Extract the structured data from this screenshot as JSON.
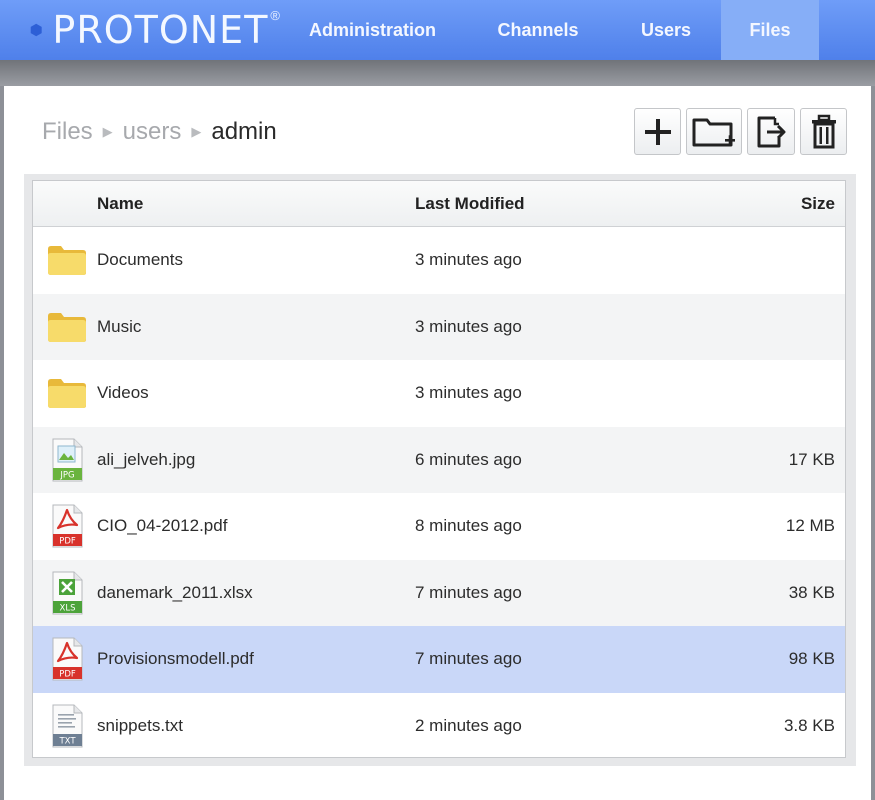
{
  "brand": {
    "name": "PROTONET",
    "reg": "®",
    "color": "#4f80ea"
  },
  "nav": [
    {
      "label": "Administration",
      "active": false
    },
    {
      "label": "Channels",
      "active": false
    },
    {
      "label": "Users",
      "active": false
    },
    {
      "label": "Files",
      "active": true
    }
  ],
  "breadcrumb": [
    {
      "label": "Files"
    },
    {
      "label": "users"
    },
    {
      "label": "admin"
    }
  ],
  "breadcrumb_sep": "▶",
  "toolbar": [
    {
      "icon": "plus-icon"
    },
    {
      "icon": "new-folder-icon"
    },
    {
      "icon": "export-icon"
    },
    {
      "icon": "trash-icon"
    }
  ],
  "table": {
    "headers": {
      "name": "Name",
      "modified": "Last Modified",
      "size": "Size"
    },
    "rows": [
      {
        "icon": "folder-icon",
        "type": "folder",
        "name": "Documents",
        "modified": "3 minutes ago",
        "size": ""
      },
      {
        "icon": "folder-icon",
        "type": "folder",
        "name": "Music",
        "modified": "3 minutes ago",
        "size": ""
      },
      {
        "icon": "folder-icon",
        "type": "folder",
        "name": "Videos",
        "modified": "3 minutes ago",
        "size": ""
      },
      {
        "icon": "jpg-file-icon",
        "type": "jpg",
        "badge": "JPG",
        "name": "ali_jelveh.jpg",
        "modified": "6 minutes ago",
        "size": "17 KB"
      },
      {
        "icon": "pdf-file-icon",
        "type": "pdf",
        "badge": "PDF",
        "name": "CIO_04-2012.pdf",
        "modified": "8 minutes ago",
        "size": "12 MB"
      },
      {
        "icon": "xls-file-icon",
        "type": "xls",
        "badge": "XLS",
        "name": "danemark_2011.xlsx",
        "modified": "7 minutes ago",
        "size": "38 KB"
      },
      {
        "icon": "pdf-file-icon",
        "type": "pdf",
        "badge": "PDF",
        "name": "Provisionsmodell.pdf",
        "modified": "7 minutes ago",
        "size": "98 KB",
        "selected": true
      },
      {
        "icon": "txt-file-icon",
        "type": "txt",
        "badge": "TXT",
        "name": "snippets.txt",
        "modified": "2 minutes ago",
        "size": "3.8 KB"
      }
    ]
  },
  "colors": {
    "selected_row": "#c9d7f8",
    "pdf": "#d8322b",
    "jpg": "#6ab43e",
    "xls": "#4ca33a",
    "txt": "#6e7f93",
    "folder": "#f5d65f"
  }
}
